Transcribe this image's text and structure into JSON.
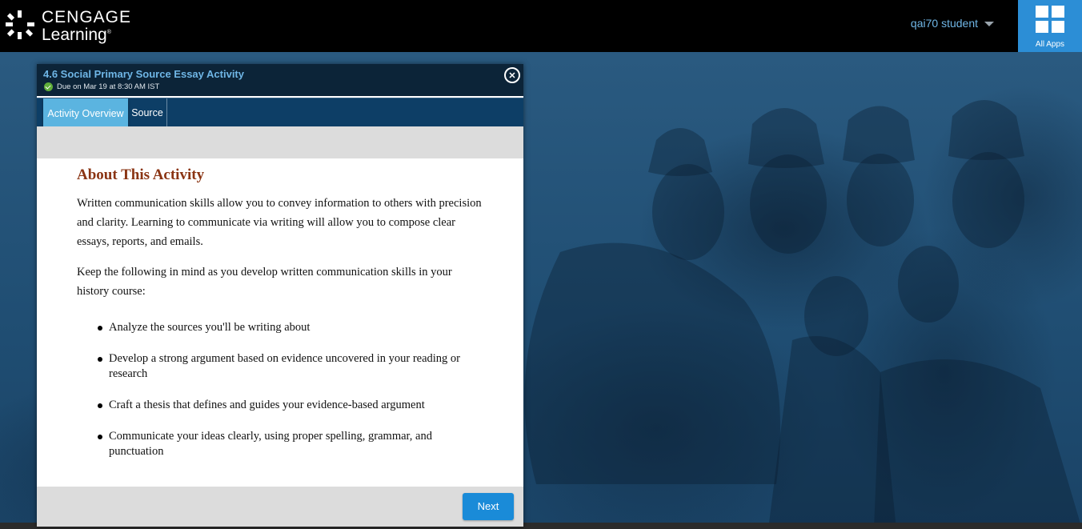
{
  "brand": {
    "name_line1": "CENGAGE",
    "name_line2": "Learning",
    "registered": "®"
  },
  "header": {
    "user_name": "qai70 student",
    "all_apps_label": "All Apps"
  },
  "modal": {
    "title": "4.6 Social Primary Source Essay Activity",
    "due": "Due on Mar 19 at 8:30 AM IST",
    "close_symbol": "✕",
    "tabs": [
      {
        "label": "Activity Overview",
        "active": true
      },
      {
        "label": "Source",
        "active": false
      }
    ],
    "heading": "About This Activity",
    "paragraphs": [
      "Written communication skills allow you to convey information to others with precision and clarity. Learning to communicate via writing will allow you to compose clear essays, reports, and emails.",
      "Keep the following in mind as you develop written communication skills in your history course:"
    ],
    "bullets": [
      "Analyze the sources you'll be writing about",
      "Develop a strong argument based on evidence uncovered in your reading or research",
      "Craft a thesis that defines and guides your evidence-based argument",
      "Communicate your ideas clearly, using proper spelling, grammar, and punctuation"
    ],
    "next_label": "Next"
  },
  "icons": {
    "logo": "cengage-logo-icon",
    "caret": "chevron-down-icon",
    "apps": "grid-icon",
    "check": "check-circle-icon",
    "close": "close-icon"
  },
  "colors": {
    "topbar": "#000000",
    "all_apps": "#2c8ed6",
    "link_blue": "#6fb6e6",
    "tabbar": "#0d3e66",
    "active_tab": "#5bb4e0",
    "heading": "#8a3413",
    "next_button": "#1a8bd8"
  }
}
